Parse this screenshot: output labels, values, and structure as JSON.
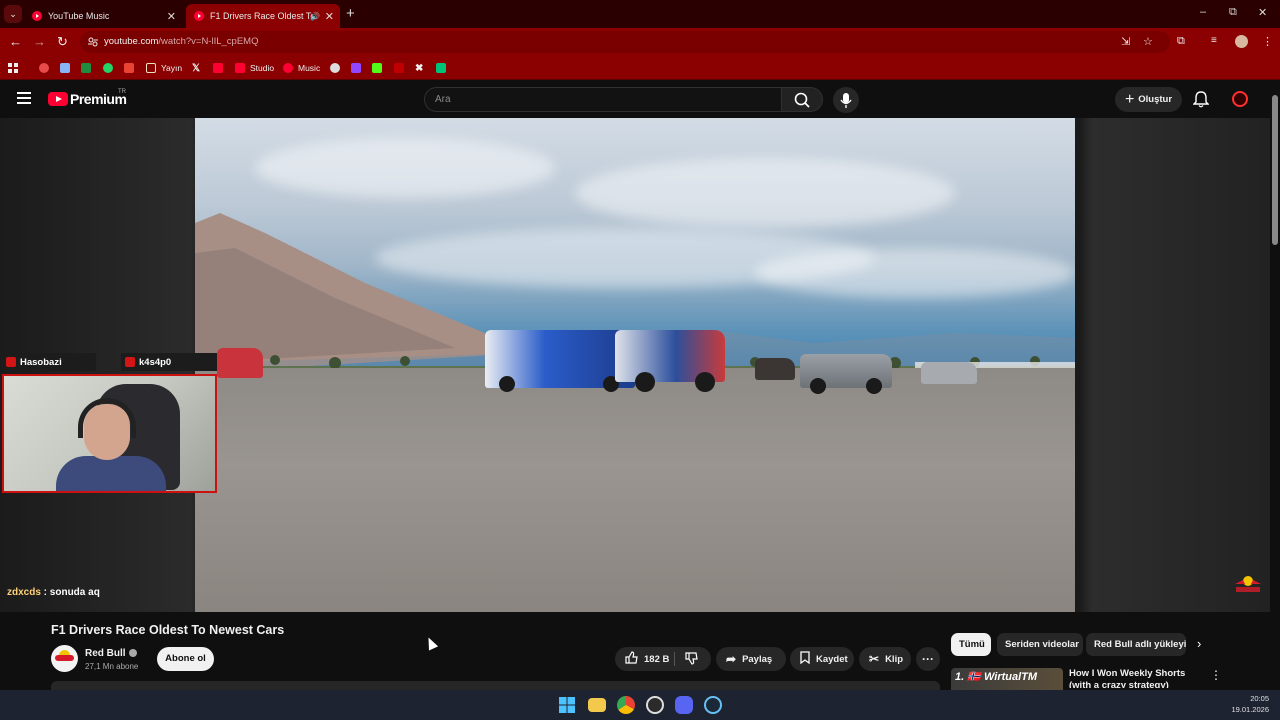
{
  "browser": {
    "tab_search_glyph": "⌄",
    "tabs": [
      {
        "title": "YouTube Music",
        "close": "✕"
      },
      {
        "title": "F1 Drivers Race Oldest To N",
        "close": "✕",
        "audio": "🔊"
      }
    ],
    "new_tab": "+",
    "window_controls": {
      "minimize": "–",
      "restore": "⧉",
      "close": "✕"
    },
    "nav": {
      "back": "←",
      "forward": "→",
      "reload": "↻"
    },
    "url_host": "youtube.com",
    "url_path": "/watch?v=N-lIL_cpEMQ",
    "toolbar_icons": {
      "install": "⇲",
      "star": "☆",
      "extensions": "⧉",
      "menu": "⋮"
    },
    "bookmarks": [
      {
        "label": "",
        "color": "#e64a4a"
      },
      {
        "label": "",
        "color": "#8ab4f8"
      },
      {
        "label": "",
        "color": "#1e8e3e"
      },
      {
        "label": "",
        "color": "#25d366"
      },
      {
        "label": "",
        "color": "#ea4335"
      },
      {
        "label": "Yayın",
        "color": "#f0c040"
      },
      {
        "label": "",
        "color": "#ffffff"
      },
      {
        "label": "",
        "color": "#ff0033"
      },
      {
        "label": "Studio",
        "color": "#ff0033"
      },
      {
        "label": "Music",
        "color": "#ff0033"
      },
      {
        "label": "",
        "color": "#dddddd"
      },
      {
        "label": "",
        "color": "#9146ff"
      },
      {
        "label": "",
        "color": "#53fc18"
      },
      {
        "label": "",
        "color": "#c00000"
      },
      {
        "label": "",
        "color": "#ffffff"
      },
      {
        "label": "",
        "color": "#00c37a"
      }
    ]
  },
  "youtube": {
    "logo_text": "Premium",
    "region": "TR",
    "search_placeholder": "Ara",
    "create_label": "Oluştur",
    "video": {
      "title": "F1 Drivers Race Oldest To Newest Cars",
      "channel": "Red Bull",
      "subscribers": "27,1 Mn abone",
      "subscribe_label": "Abone ol",
      "likes": "182 B",
      "share_label": "Paylaş",
      "save_label": "Kaydet",
      "clip_label": "Klip",
      "more_label": "···"
    },
    "chips": [
      "Tümü",
      "Seriden videolar",
      "Red Bull adlı yükleyici"
    ],
    "recommendation": {
      "thumb_text": "1. 🇳🇴 WirtualTM",
      "title": "How I Won Weekly Shorts (with a crazy strategy)"
    }
  },
  "stream_overlay": {
    "chat_users": [
      "Hasobazi",
      "k4s4p0"
    ],
    "chat_message_user": "zdxcds",
    "chat_message_text": " : sonuda aq"
  },
  "taskbar": {
    "apps": [
      {
        "name": "windows-start",
        "color": "#4cc2ff"
      },
      {
        "name": "file-explorer",
        "color": "#f2c94c"
      },
      {
        "name": "chrome",
        "color": "#ea4335"
      },
      {
        "name": "obs",
        "color": "#dddddd"
      },
      {
        "name": "discord",
        "color": "#5865f2"
      },
      {
        "name": "steam",
        "color": "#66c0f4"
      }
    ],
    "time": "20:05",
    "date": "19.01.2026"
  }
}
